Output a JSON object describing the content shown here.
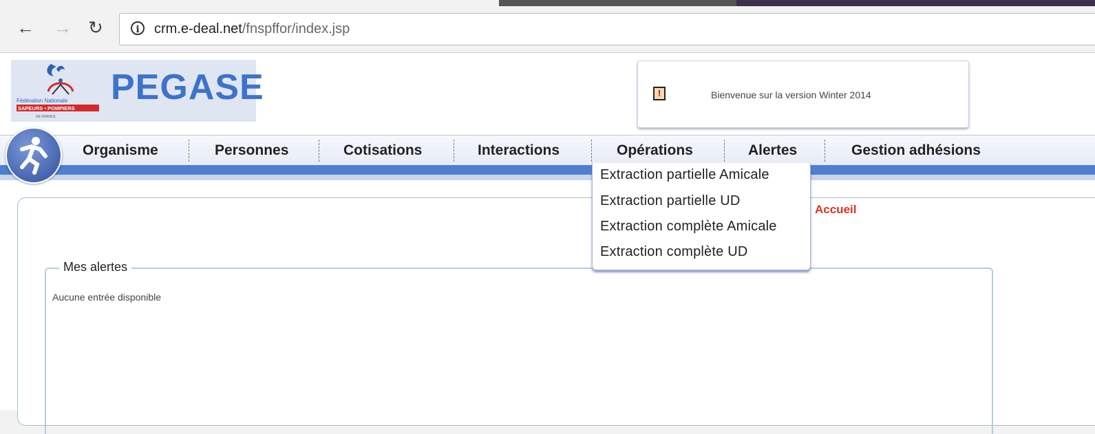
{
  "browser": {
    "url_domain": "crm.e-deal.net",
    "url_path": "/fnspffor/index.jsp",
    "info_symbol": "i"
  },
  "logo": {
    "app_name": "PEGASE",
    "org_line1": "Fédération Nationale",
    "org_line2": "SAPEURS • POMPIERS",
    "org_line3": "DE FRANCE"
  },
  "welcome": {
    "icon": "clipboard-alert-icon",
    "message": "Bienvenue sur la version Winter 2014"
  },
  "menu": {
    "items": [
      {
        "label": "Organisme"
      },
      {
        "label": "Personnes"
      },
      {
        "label": "Cotisations"
      },
      {
        "label": "Interactions"
      },
      {
        "label": "Opérations"
      },
      {
        "label": "Alertes"
      },
      {
        "label": "Gestion adhésions"
      }
    ]
  },
  "dropdown": {
    "items": [
      {
        "label": "Extraction partielle Amicale"
      },
      {
        "label": "Extraction partielle UD"
      },
      {
        "label": "Extraction complète Amicale"
      },
      {
        "label": "Extraction complète UD"
      }
    ]
  },
  "content": {
    "breadcrumb": "Accueil",
    "alerts_legend": "Mes alertes",
    "alerts_empty": "Aucune entrée disponible"
  },
  "colors": {
    "accent_blue": "#4f7fd0",
    "logo_blue": "#3d73c9",
    "breadcrumb_red": "#e0301e"
  }
}
